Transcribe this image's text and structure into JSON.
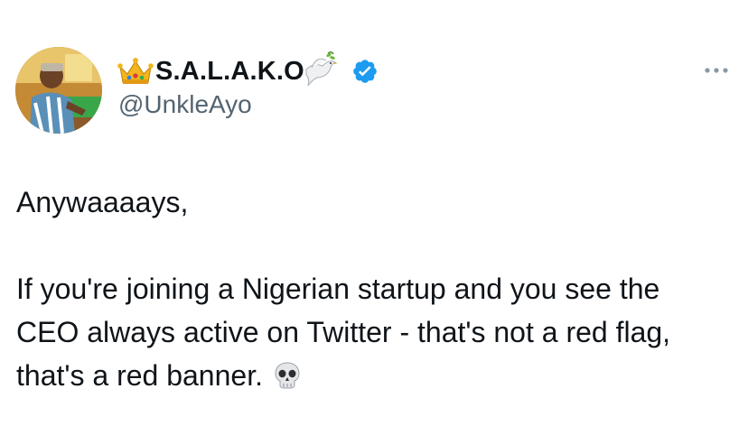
{
  "author": {
    "display_name": "S.A.L.A.K.O",
    "handle": "@UnkleAyo",
    "name_prefix_icon": "crown-icon",
    "name_suffix_icon": "dove-icon",
    "verified_icon": "verified-badge-icon"
  },
  "tweet": {
    "line1": "Anywaaaays,",
    "body": "If you're joining a Nigerian startup and you see the CEO always active on Twitter - that's not a red flag, that's a red banner.",
    "trailing_icon": "skull-icon"
  },
  "menu_icon": "more-options-icon",
  "colors": {
    "text": "#0f1419",
    "secondary_text": "#536471",
    "verified_blue": "#1d9bf0",
    "background": "#ffffff"
  }
}
